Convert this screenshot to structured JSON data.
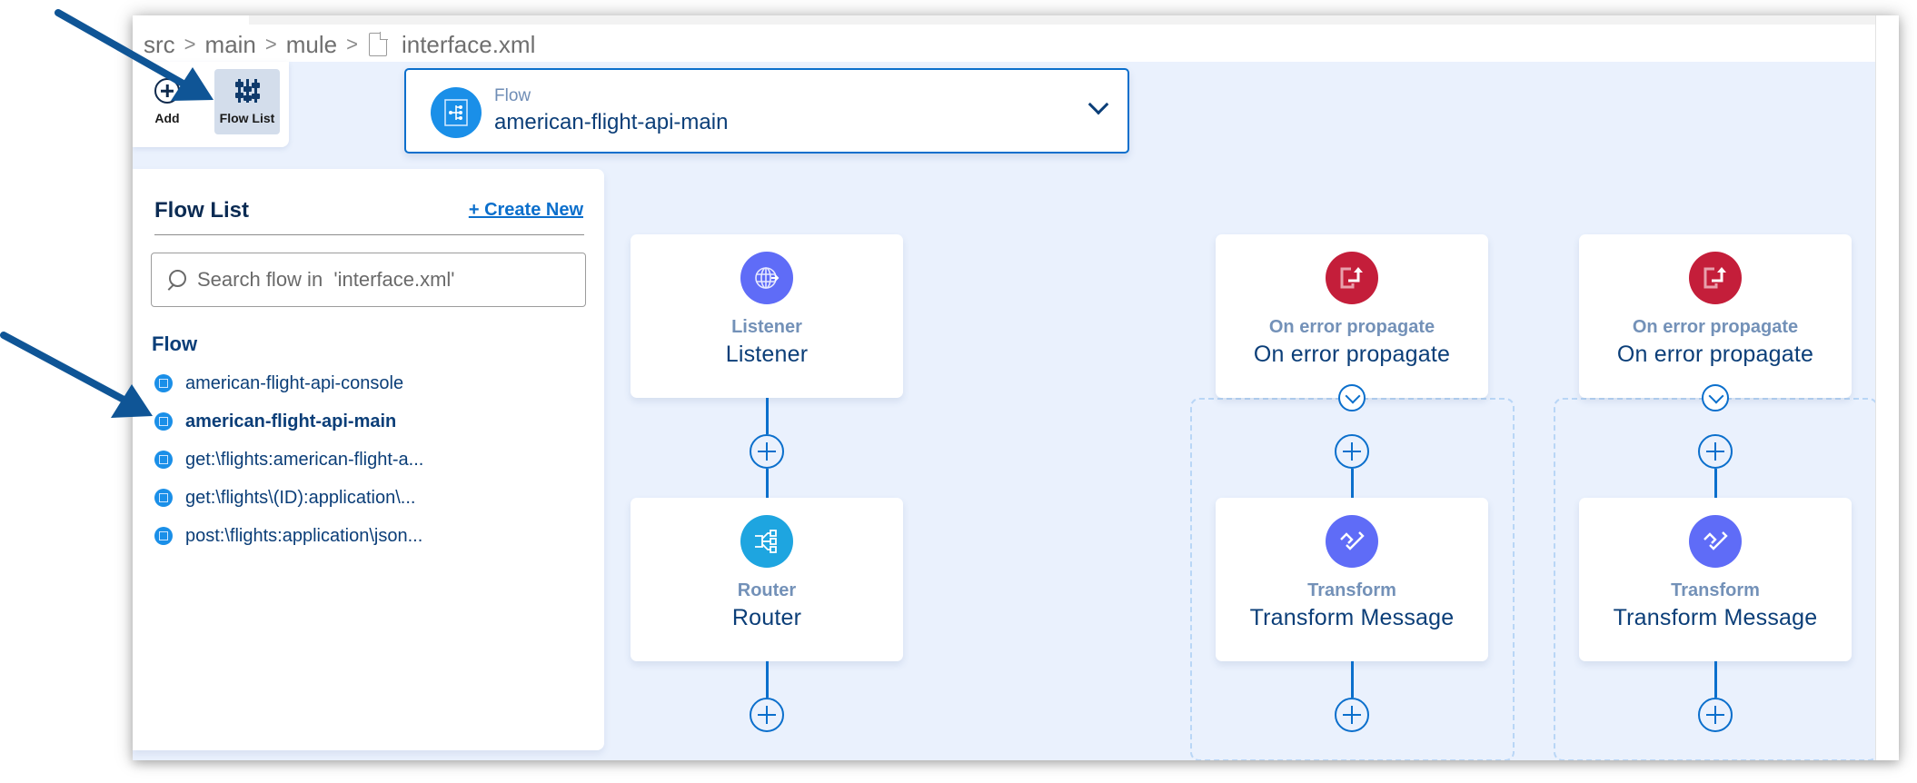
{
  "breadcrumb": {
    "items": [
      "src",
      "main",
      "mule"
    ],
    "separator": ">",
    "file_icon": "file-icon",
    "file": "interface.xml"
  },
  "toolbar": {
    "add_label": "Add",
    "add_icon": "plus-circle-icon",
    "flow_list_label": "Flow List",
    "flow_list_icon": "sliders-icon",
    "flow_list_active": true
  },
  "flow_selector": {
    "label": "Flow",
    "value": "american-flight-api-main",
    "icon": "flow-icon",
    "chevron": "chevron-down-icon"
  },
  "flow_list_panel": {
    "title": "Flow List",
    "create_new_label": "+ Create New",
    "search_placeholder": "Search flow in  'interface.xml'",
    "search_value": "",
    "section_label": "Flow",
    "items": [
      {
        "label": "american-flight-api-console",
        "active": false
      },
      {
        "label": "american-flight-api-main",
        "active": true
      },
      {
        "label": "get:\\flights:american-flight-a...",
        "active": false
      },
      {
        "label": "get:\\flights\\(ID):application\\...",
        "active": false
      },
      {
        "label": "post:\\flights:application\\json...",
        "active": false
      }
    ]
  },
  "diagram": {
    "main_flow": [
      {
        "type": "Listener",
        "name": "Listener",
        "icon": "globe-listener-icon",
        "color": "#5f6cf7"
      },
      {
        "type": "Router",
        "name": "Router",
        "icon": "router-icon",
        "color": "#1ea5e0"
      }
    ],
    "error_handlers": [
      {
        "type": "On error propagate",
        "name": "On error propagate",
        "icon": "error-propagate-icon",
        "color": "#c41e3a",
        "children": [
          {
            "type": "Transform",
            "name": "Transform Message",
            "icon": "transform-icon",
            "color": "#5f6cf7"
          }
        ]
      },
      {
        "type": "On error propagate",
        "name": "On error propagate",
        "icon": "error-propagate-icon",
        "color": "#c41e3a",
        "children": [
          {
            "type": "Transform",
            "name": "Transform Message",
            "icon": "transform-icon",
            "color": "#5f6cf7"
          }
        ]
      }
    ]
  },
  "colors": {
    "canvas_bg": "#eaf1fd",
    "accent": "#0b6fcc",
    "text_dark": "#0b3e78",
    "arrow": "#0f5596"
  }
}
